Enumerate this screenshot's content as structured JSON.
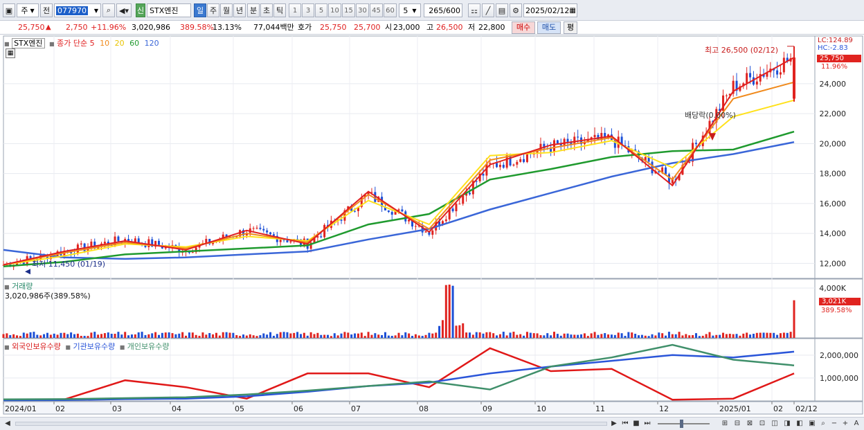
{
  "toolbar": {
    "market_tab": "주",
    "prev_label": "전",
    "code": "077970",
    "new_badge": "신",
    "stock_name": "STX엔진",
    "period_tabs": [
      "일",
      "주",
      "월",
      "년",
      "분",
      "초",
      "틱"
    ],
    "active_period": "일",
    "interval_numbers": [
      "1",
      "3",
      "5",
      "10",
      "15",
      "30",
      "45",
      "60"
    ],
    "interval_value": "5",
    "bar_count": "265",
    "bar_total": "/600",
    "date": "2025/02/12"
  },
  "quote": {
    "price": "25,750",
    "arrow": "▲",
    "change": "2,750",
    "change_pct": "+11.96%",
    "volume": "3,020,986",
    "volume_ratio": "389.58%",
    "turnover": "13.13%",
    "amount": "77,044백만",
    "hoga_label": "호가",
    "ask": "25,750",
    "bid": "25,700",
    "open_label": "시",
    "open": "23,000",
    "high_label": "고",
    "high": "26,500",
    "low_label": "저",
    "low": "22,800",
    "buy_label": "매수",
    "sell_label": "매도",
    "eval_label": "평"
  },
  "price_panel": {
    "stock_label": "STX엔진",
    "ma_title": "종가 단순",
    "ma_periods": [
      "5",
      "10",
      "20",
      "60",
      "120"
    ],
    "lc": "LC:124.89",
    "hc": "HC:-2.83",
    "current_price": "25,750",
    "current_pct": "11.96%",
    "high_annotation": "최고 26,500 (02/12)",
    "low_annotation": "최저 11,450 (01/19)",
    "dividend_annotation": "배당락(0.00%)"
  },
  "volume_panel": {
    "title": "거래량",
    "value": "3,020,986주(389.58%)",
    "current": "3,021K",
    "current_pct": "389.58%"
  },
  "holdings_panel": {
    "labels": [
      "외국인보유수량",
      "기관보유수량",
      "개인보유수량"
    ]
  },
  "colors": {
    "up": "#e0231f",
    "down": "#1c4fd6",
    "ma5": "#e02020",
    "ma10": "#f08a1c",
    "ma20": "#ffe11a",
    "ma60": "#1f9a2e",
    "ma120": "#3a66d8",
    "foreign": "#e01818",
    "institution": "#2a55d9",
    "individual": "#3f8f6a"
  },
  "chart_data": [
    {
      "type": "candlestick",
      "title": "STX엔진",
      "x_ticks": [
        "2024/01",
        "02",
        "03",
        "04",
        "05",
        "06",
        "07",
        "08",
        "09",
        "10",
        "11",
        "12",
        "2025/01",
        "02",
        "02/12"
      ],
      "y_ticks": [
        "12,000",
        "14,000",
        "16,000",
        "18,000",
        "20,000",
        "22,000",
        "24,000"
      ],
      "ylim": [
        11000,
        27000
      ],
      "monthly_close": [
        {
          "month": "2024/01",
          "close": 11900
        },
        {
          "month": "2024/02",
          "close": 12800
        },
        {
          "month": "2024/03",
          "close": 13600
        },
        {
          "month": "2024/04",
          "close": 12900
        },
        {
          "month": "2024/05",
          "close": 14200
        },
        {
          "month": "2024/06",
          "close": 13300
        },
        {
          "month": "2024/07",
          "close": 16600
        },
        {
          "month": "2024/08",
          "close": 14100
        },
        {
          "month": "2024/09",
          "close": 18500
        },
        {
          "month": "2024/10",
          "close": 19800
        },
        {
          "month": "2024/11",
          "close": 20300
        },
        {
          "month": "2024/12",
          "close": 17500
        },
        {
          "month": "2025/01",
          "close": 23800
        },
        {
          "month": "2025/02/12",
          "close": 25750
        }
      ],
      "series": [
        {
          "name": "5",
          "values": [
            11900,
            12800,
            13500,
            12900,
            14200,
            13300,
            16800,
            14100,
            18600,
            19900,
            20500,
            17200,
            23500,
            25750
          ]
        },
        {
          "name": "10",
          "values": [
            11900,
            12700,
            13400,
            13000,
            14000,
            13400,
            16600,
            14300,
            18900,
            19700,
            20400,
            17600,
            23000,
            24100
          ]
        },
        {
          "name": "20",
          "values": [
            11900,
            12500,
            13300,
            13100,
            13800,
            13500,
            16200,
            14600,
            19200,
            19400,
            20200,
            18400,
            21800,
            22900
          ]
        },
        {
          "name": "60",
          "values": [
            11800,
            12100,
            12600,
            12800,
            13000,
            13200,
            14600,
            15300,
            17600,
            18300,
            19100,
            19500,
            19600,
            20800
          ]
        },
        {
          "name": "120",
          "values": [
            12900,
            12400,
            12300,
            12400,
            12600,
            12800,
            13600,
            14300,
            15600,
            16700,
            17800,
            18700,
            19300,
            20100
          ]
        }
      ]
    },
    {
      "type": "bar",
      "title": "거래량",
      "y_ticks": [
        "4,000K"
      ],
      "ylim": [
        0,
        4500
      ],
      "unit": "K",
      "peaks": [
        {
          "date": "2024/08",
          "value": 4300
        },
        {
          "date": "2025/02/12",
          "value": 3021
        }
      ]
    },
    {
      "type": "line",
      "y_ticks": [
        "2,000,000",
        "1,000,000"
      ],
      "ylim": [
        0,
        2600000
      ],
      "series": [
        {
          "name": "외국인보유수량",
          "values": [
            50000,
            60000,
            900000,
            600000,
            100000,
            1200000,
            1200000,
            600000,
            2300000,
            1300000,
            1400000,
            50000,
            100000,
            1200000
          ]
        },
        {
          "name": "기관보유수량",
          "values": [
            30000,
            40000,
            80000,
            100000,
            200000,
            400000,
            650000,
            800000,
            1200000,
            1500000,
            1750000,
            2000000,
            1900000,
            2150000
          ]
        },
        {
          "name": "개인보유수량",
          "values": [
            70000,
            80000,
            120000,
            160000,
            280000,
            450000,
            650000,
            850000,
            500000,
            1500000,
            1900000,
            2450000,
            1800000,
            1550000
          ]
        }
      ]
    }
  ]
}
